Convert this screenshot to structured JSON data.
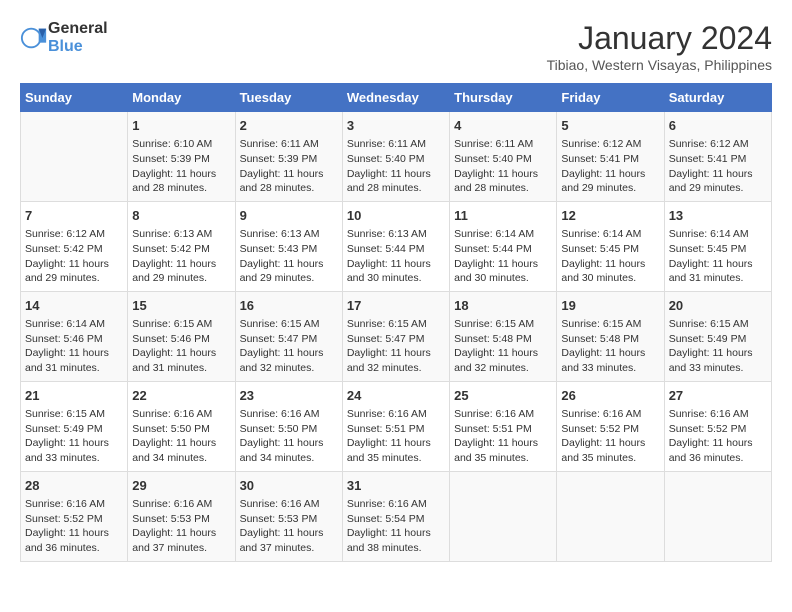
{
  "logo": {
    "general": "General",
    "blue": "Blue"
  },
  "title": "January 2024",
  "subtitle": "Tibiao, Western Visayas, Philippines",
  "days": [
    "Sunday",
    "Monday",
    "Tuesday",
    "Wednesday",
    "Thursday",
    "Friday",
    "Saturday"
  ],
  "weeks": [
    [
      {
        "num": "",
        "sunrise": "",
        "sunset": "",
        "daylight": ""
      },
      {
        "num": "1",
        "sunrise": "Sunrise: 6:10 AM",
        "sunset": "Sunset: 5:39 PM",
        "daylight": "Daylight: 11 hours and 28 minutes."
      },
      {
        "num": "2",
        "sunrise": "Sunrise: 6:11 AM",
        "sunset": "Sunset: 5:39 PM",
        "daylight": "Daylight: 11 hours and 28 minutes."
      },
      {
        "num": "3",
        "sunrise": "Sunrise: 6:11 AM",
        "sunset": "Sunset: 5:40 PM",
        "daylight": "Daylight: 11 hours and 28 minutes."
      },
      {
        "num": "4",
        "sunrise": "Sunrise: 6:11 AM",
        "sunset": "Sunset: 5:40 PM",
        "daylight": "Daylight: 11 hours and 28 minutes."
      },
      {
        "num": "5",
        "sunrise": "Sunrise: 6:12 AM",
        "sunset": "Sunset: 5:41 PM",
        "daylight": "Daylight: 11 hours and 29 minutes."
      },
      {
        "num": "6",
        "sunrise": "Sunrise: 6:12 AM",
        "sunset": "Sunset: 5:41 PM",
        "daylight": "Daylight: 11 hours and 29 minutes."
      }
    ],
    [
      {
        "num": "7",
        "sunrise": "Sunrise: 6:12 AM",
        "sunset": "Sunset: 5:42 PM",
        "daylight": "Daylight: 11 hours and 29 minutes."
      },
      {
        "num": "8",
        "sunrise": "Sunrise: 6:13 AM",
        "sunset": "Sunset: 5:42 PM",
        "daylight": "Daylight: 11 hours and 29 minutes."
      },
      {
        "num": "9",
        "sunrise": "Sunrise: 6:13 AM",
        "sunset": "Sunset: 5:43 PM",
        "daylight": "Daylight: 11 hours and 29 minutes."
      },
      {
        "num": "10",
        "sunrise": "Sunrise: 6:13 AM",
        "sunset": "Sunset: 5:44 PM",
        "daylight": "Daylight: 11 hours and 30 minutes."
      },
      {
        "num": "11",
        "sunrise": "Sunrise: 6:14 AM",
        "sunset": "Sunset: 5:44 PM",
        "daylight": "Daylight: 11 hours and 30 minutes."
      },
      {
        "num": "12",
        "sunrise": "Sunrise: 6:14 AM",
        "sunset": "Sunset: 5:45 PM",
        "daylight": "Daylight: 11 hours and 30 minutes."
      },
      {
        "num": "13",
        "sunrise": "Sunrise: 6:14 AM",
        "sunset": "Sunset: 5:45 PM",
        "daylight": "Daylight: 11 hours and 31 minutes."
      }
    ],
    [
      {
        "num": "14",
        "sunrise": "Sunrise: 6:14 AM",
        "sunset": "Sunset: 5:46 PM",
        "daylight": "Daylight: 11 hours and 31 minutes."
      },
      {
        "num": "15",
        "sunrise": "Sunrise: 6:15 AM",
        "sunset": "Sunset: 5:46 PM",
        "daylight": "Daylight: 11 hours and 31 minutes."
      },
      {
        "num": "16",
        "sunrise": "Sunrise: 6:15 AM",
        "sunset": "Sunset: 5:47 PM",
        "daylight": "Daylight: 11 hours and 32 minutes."
      },
      {
        "num": "17",
        "sunrise": "Sunrise: 6:15 AM",
        "sunset": "Sunset: 5:47 PM",
        "daylight": "Daylight: 11 hours and 32 minutes."
      },
      {
        "num": "18",
        "sunrise": "Sunrise: 6:15 AM",
        "sunset": "Sunset: 5:48 PM",
        "daylight": "Daylight: 11 hours and 32 minutes."
      },
      {
        "num": "19",
        "sunrise": "Sunrise: 6:15 AM",
        "sunset": "Sunset: 5:48 PM",
        "daylight": "Daylight: 11 hours and 33 minutes."
      },
      {
        "num": "20",
        "sunrise": "Sunrise: 6:15 AM",
        "sunset": "Sunset: 5:49 PM",
        "daylight": "Daylight: 11 hours and 33 minutes."
      }
    ],
    [
      {
        "num": "21",
        "sunrise": "Sunrise: 6:15 AM",
        "sunset": "Sunset: 5:49 PM",
        "daylight": "Daylight: 11 hours and 33 minutes."
      },
      {
        "num": "22",
        "sunrise": "Sunrise: 6:16 AM",
        "sunset": "Sunset: 5:50 PM",
        "daylight": "Daylight: 11 hours and 34 minutes."
      },
      {
        "num": "23",
        "sunrise": "Sunrise: 6:16 AM",
        "sunset": "Sunset: 5:50 PM",
        "daylight": "Daylight: 11 hours and 34 minutes."
      },
      {
        "num": "24",
        "sunrise": "Sunrise: 6:16 AM",
        "sunset": "Sunset: 5:51 PM",
        "daylight": "Daylight: 11 hours and 35 minutes."
      },
      {
        "num": "25",
        "sunrise": "Sunrise: 6:16 AM",
        "sunset": "Sunset: 5:51 PM",
        "daylight": "Daylight: 11 hours and 35 minutes."
      },
      {
        "num": "26",
        "sunrise": "Sunrise: 6:16 AM",
        "sunset": "Sunset: 5:52 PM",
        "daylight": "Daylight: 11 hours and 35 minutes."
      },
      {
        "num": "27",
        "sunrise": "Sunrise: 6:16 AM",
        "sunset": "Sunset: 5:52 PM",
        "daylight": "Daylight: 11 hours and 36 minutes."
      }
    ],
    [
      {
        "num": "28",
        "sunrise": "Sunrise: 6:16 AM",
        "sunset": "Sunset: 5:52 PM",
        "daylight": "Daylight: 11 hours and 36 minutes."
      },
      {
        "num": "29",
        "sunrise": "Sunrise: 6:16 AM",
        "sunset": "Sunset: 5:53 PM",
        "daylight": "Daylight: 11 hours and 37 minutes."
      },
      {
        "num": "30",
        "sunrise": "Sunrise: 6:16 AM",
        "sunset": "Sunset: 5:53 PM",
        "daylight": "Daylight: 11 hours and 37 minutes."
      },
      {
        "num": "31",
        "sunrise": "Sunrise: 6:16 AM",
        "sunset": "Sunset: 5:54 PM",
        "daylight": "Daylight: 11 hours and 38 minutes."
      },
      {
        "num": "",
        "sunrise": "",
        "sunset": "",
        "daylight": ""
      },
      {
        "num": "",
        "sunrise": "",
        "sunset": "",
        "daylight": ""
      },
      {
        "num": "",
        "sunrise": "",
        "sunset": "",
        "daylight": ""
      }
    ]
  ]
}
